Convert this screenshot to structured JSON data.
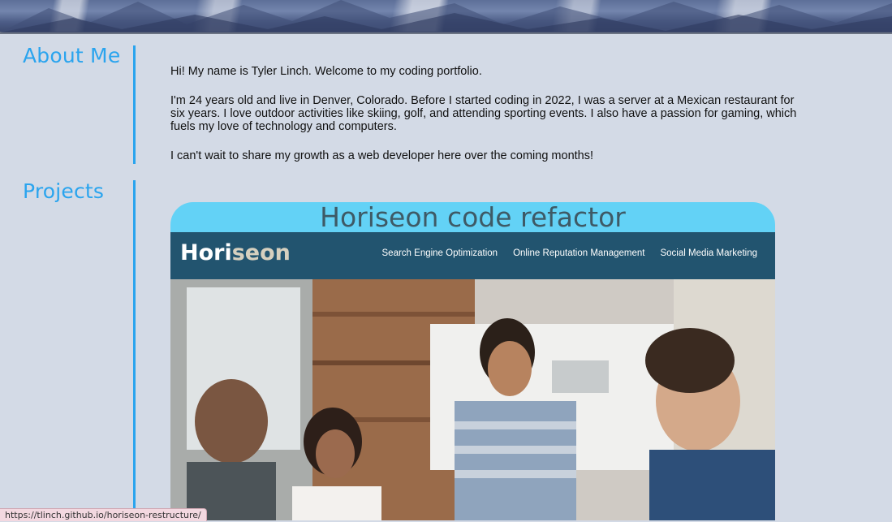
{
  "about": {
    "heading": "About Me",
    "paragraphs": [
      "Hi! My name is Tyler Linch. Welcome to my coding portfolio.",
      "I'm 24 years old and live in Denver, Colorado. Before I started coding in 2022, I was a server at a Mexican restaurant for six years. I love outdoor activities like skiing, golf, and attending sporting events. I also have a passion for gaming, which fuels my love of technology and computers.",
      "I can't wait to share my growth as a web developer here over the coming months!"
    ]
  },
  "projects": {
    "heading": "Projects",
    "items": [
      {
        "title": "Horiseon code refactor",
        "preview": {
          "logo_main": "Hori",
          "logo_accent": "seon",
          "nav_links": [
            "Search Engine Optimization",
            "Online Reputation Management",
            "Social Media Marketing"
          ]
        }
      }
    ]
  },
  "status_bar": {
    "url": "https://tlinch.github.io/horiseon-restructure/"
  },
  "colors": {
    "accent": "#2aa4ee",
    "background": "#d3dae6",
    "project_title_bar": "#63d2f6",
    "preview_nav": "#22546f"
  }
}
